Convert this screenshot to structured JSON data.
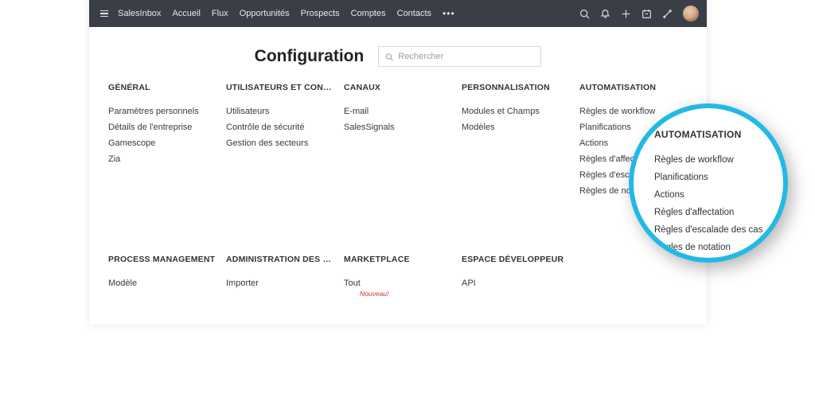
{
  "topnav": {
    "brand": "SalesInbox",
    "items": [
      "Accueil",
      "Flux",
      "Opportunités",
      "Prospects",
      "Comptes",
      "Contacts"
    ]
  },
  "page": {
    "title": "Configuration",
    "search_placeholder": "Rechercher"
  },
  "sections_row1": [
    {
      "title": "GÉNÉRAL",
      "items": [
        "Paramètres personnels",
        "Détails de l'entreprise",
        "Gamescope",
        "Zia"
      ]
    },
    {
      "title": "UTILISATEURS ET CONTR…",
      "items": [
        "Utilisateurs",
        "Contrôle de sécurité",
        "Gestion des secteurs"
      ]
    },
    {
      "title": "CANAUX",
      "items": [
        "E-mail",
        "SalesSignals"
      ]
    },
    {
      "title": "PERSONNALISATION",
      "items": [
        "Modules et Champs",
        "Modèles"
      ]
    },
    {
      "title": "AUTOMATISATION",
      "items": [
        "Règles de workflow",
        "Planifications",
        "Actions",
        "Règles d'affectation",
        "Règles d'escalade des cas",
        "Règles de notation"
      ]
    }
  ],
  "sections_row2": [
    {
      "title": "PROCESS MANAGEMENT",
      "items": [
        "Modèle"
      ]
    },
    {
      "title": "ADMINISTRATION DES DO…",
      "items": [
        "Importer"
      ]
    },
    {
      "title": "MARKETPLACE",
      "items": [
        "Tout"
      ],
      "badge": "Nouveau!"
    },
    {
      "title": "ESPACE DÉVELOPPEUR",
      "items": [
        "API"
      ]
    },
    {
      "title": "",
      "items": []
    }
  ],
  "bubble": {
    "title": "AUTOMATISATION",
    "items": [
      "Règles de workflow",
      "Planifications",
      "Actions",
      "Règles d'affectation",
      "Règles d'escalade des cas",
      "Règles de notation"
    ]
  }
}
